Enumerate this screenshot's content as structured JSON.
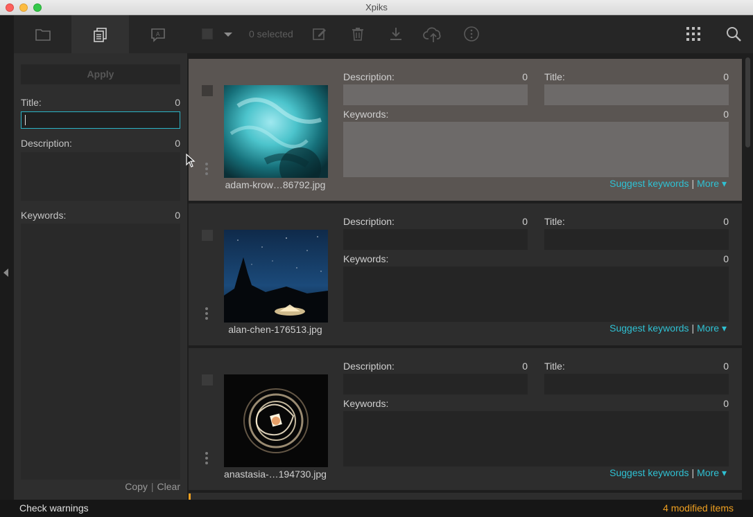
{
  "window": {
    "title": "Xpiks"
  },
  "toolbar": {
    "tabs": [
      {
        "name": "folder",
        "icon": "folder-icon"
      },
      {
        "name": "combined-edit",
        "icon": "copy-icon",
        "active": true
      },
      {
        "name": "quick-edit",
        "icon": "text-frame-icon"
      }
    ],
    "selected_text": "0 selected",
    "actions": [
      "edit-icon",
      "trash-icon",
      "download-icon",
      "upload-cloud-icon",
      "info-icon"
    ],
    "right": [
      "grid-icon",
      "search-icon"
    ]
  },
  "left_panel": {
    "apply_label": "Apply",
    "title_label": "Title:",
    "title_count": "0",
    "title_value": "",
    "description_label": "Description:",
    "description_count": "0",
    "keywords_label": "Keywords:",
    "keywords_count": "0",
    "copy_label": "Copy",
    "sep": "|",
    "clear_label": "Clear"
  },
  "items": [
    {
      "filename": "adam-krow…86792.jpg",
      "selected": true,
      "description_label": "Description:",
      "description_count": "0",
      "title_label": "Title:",
      "title_count": "0",
      "keywords_label": "Keywords:",
      "keywords_count": "0",
      "suggest_label": "Suggest keywords",
      "sep": "|",
      "more_label": "More ▾"
    },
    {
      "filename": "alan-chen-176513.jpg",
      "selected": false,
      "description_label": "Description:",
      "description_count": "0",
      "title_label": "Title:",
      "title_count": "0",
      "keywords_label": "Keywords:",
      "keywords_count": "0",
      "suggest_label": "Suggest keywords",
      "sep": "|",
      "more_label": "More ▾"
    },
    {
      "filename": "anastasia-…194730.jpg",
      "selected": false,
      "description_label": "Description:",
      "description_count": "0",
      "title_label": "Title:",
      "title_count": "0",
      "keywords_label": "Keywords:",
      "keywords_count": "0",
      "suggest_label": "Suggest keywords",
      "sep": "|",
      "more_label": "More ▾"
    }
  ],
  "status": {
    "check_warnings": "Check warnings",
    "modified": "4 modified items"
  },
  "colors": {
    "accent": "#2fc1d3",
    "warning": "#f0a020",
    "selected_item": "#5a5552"
  }
}
